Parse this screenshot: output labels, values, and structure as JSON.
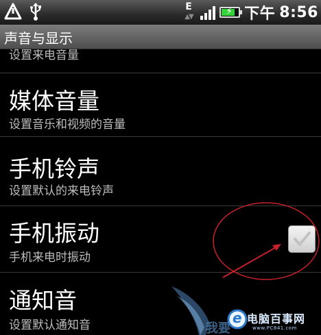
{
  "status_bar": {
    "network_type": "E",
    "time_period": "下午",
    "time": "8:56",
    "battery_level": 0.8,
    "battery_color": "#35d33a",
    "signal_bars": 4,
    "icons": [
      "warning-triangle-icon",
      "usb-icon",
      "data-arrows-icon",
      "signal-icon",
      "battery-charging-icon"
    ]
  },
  "title_bar": {
    "title": "声音与显示"
  },
  "settings": [
    {
      "summary": "设置来电音量"
    },
    {
      "label": "媒体音量",
      "summary": "设置音乐和视频的音量"
    },
    {
      "label": "手机铃声",
      "summary": "设置默认的来电铃声"
    },
    {
      "label": "手机振动",
      "summary": "手机来电时振动",
      "checked": false
    },
    {
      "label": "通知音",
      "summary": "设置默认通知音"
    }
  ],
  "annotation": {
    "color": "#c8202a"
  },
  "watermark": {
    "site_name": "电脑百事网",
    "url": "www.PC841.com",
    "logo_letter": "e",
    "partial_text": "我要"
  }
}
